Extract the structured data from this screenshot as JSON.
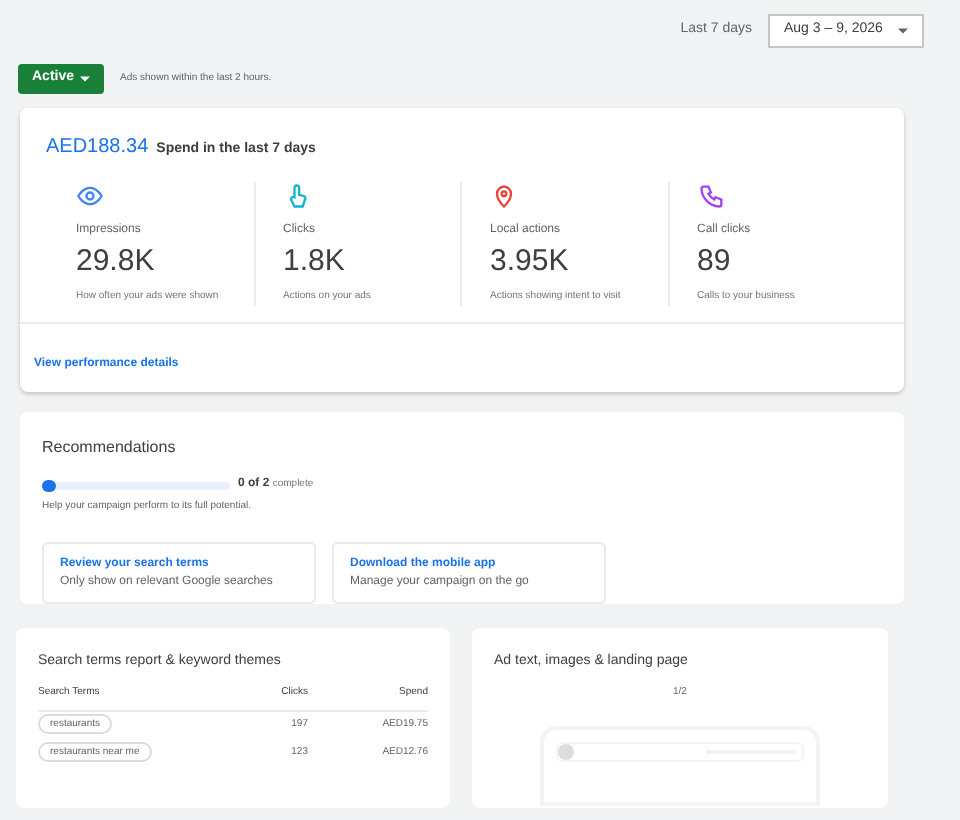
{
  "date_range": {
    "label": "Last 7 days",
    "value": "Aug 3 – 9, 2026"
  },
  "status": {
    "label": "Active",
    "note": "Ads shown within the last 2 hours."
  },
  "summary": {
    "amount": "AED188.34",
    "caption": "Spend in the last 7 days",
    "metrics": [
      {
        "kind": "eye",
        "color": "#4285f4",
        "label": "Impressions",
        "value": "29.8K",
        "description": "How often your ads were shown"
      },
      {
        "kind": "tap",
        "color": "#12b5cb",
        "label": "Clicks",
        "value": "1.8K",
        "description": "Actions on your ads"
      },
      {
        "kind": "pin",
        "color": "#ea4335",
        "label": "Local actions",
        "value": "3.95K",
        "description": "Actions showing intent to visit"
      },
      {
        "kind": "phone",
        "color": "#a142f4",
        "label": "Call clicks",
        "value": "89",
        "description": "Calls to your business"
      }
    ],
    "link": "View performance details"
  },
  "recommendations": {
    "title": "Recommendations",
    "level": 0,
    "progress": "0 of 2",
    "progress_suffix": "complete",
    "hint": "Help your campaign perform to its full potential.",
    "cards": [
      {
        "title": "Review your search terms",
        "subtitle": "Only show on relevant Google searches"
      },
      {
        "title": "Download the mobile app",
        "subtitle": "Manage your campaign on the go"
      }
    ]
  },
  "search_terms": {
    "title": "Search terms report & keyword themes",
    "columns": [
      "Search Terms",
      "Clicks",
      "Spend"
    ],
    "rows": [
      {
        "term": "restaurants",
        "clicks": "197",
        "spend": "AED19.75"
      },
      {
        "term": "restaurants near me",
        "clicks": "123",
        "spend": "AED12.76"
      }
    ]
  },
  "ad_preview": {
    "title": "Ad text, images & landing page",
    "pager": "1/2"
  }
}
